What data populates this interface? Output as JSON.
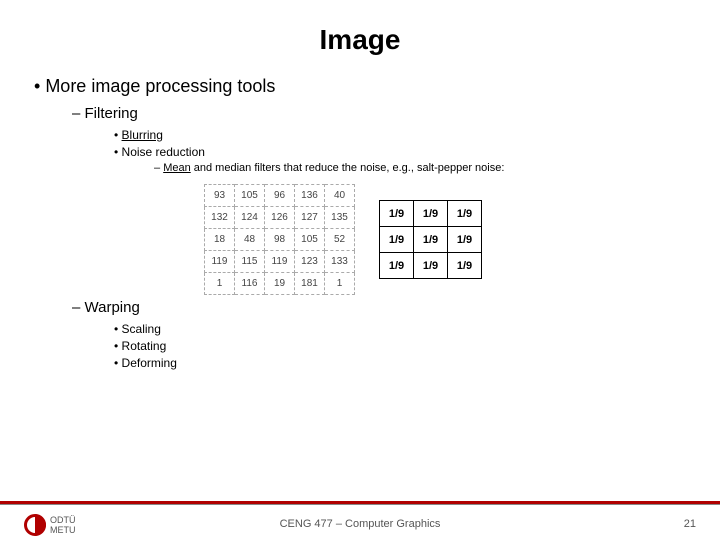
{
  "title": "Image",
  "bullets": {
    "main": "More image processing tools",
    "filtering": "Filtering",
    "blurring": "Blurring",
    "noise": "Noise reduction",
    "mean_prefix": "Mean",
    "mean_rest": " and median filters that reduce the noise, e.g., salt-pepper noise:",
    "warping": "Warping",
    "scaling": "Scaling",
    "rotating": "Rotating",
    "deforming": "Deforming"
  },
  "pixel_grid": [
    [
      "93",
      "105",
      "96",
      "136",
      "40"
    ],
    [
      "132",
      "124",
      "126",
      "127",
      "135"
    ],
    [
      "18",
      "48",
      "98",
      "105",
      "52"
    ],
    [
      "119",
      "115",
      "119",
      "123",
      "133"
    ],
    [
      "1",
      "116",
      "19",
      "181",
      "1"
    ]
  ],
  "kernel": [
    [
      "1/9",
      "1/9",
      "1/9"
    ],
    [
      "1/9",
      "1/9",
      "1/9"
    ],
    [
      "1/9",
      "1/9",
      "1/9"
    ]
  ],
  "logo": {
    "line1": "ODTÜ",
    "line2": "METU"
  },
  "footer": {
    "center": "CENG 477 – Computer Graphics",
    "page": "21"
  }
}
